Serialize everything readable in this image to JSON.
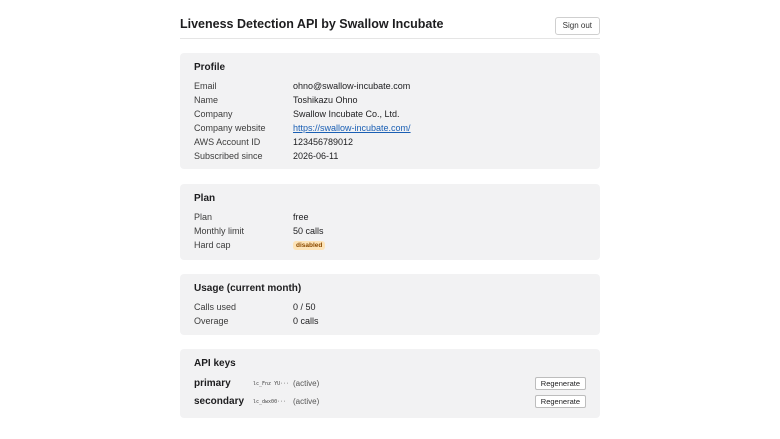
{
  "header": {
    "title": "Liveness Detection API by Swallow Incubate",
    "sign_out_label": "Sign out"
  },
  "profile": {
    "title": "Profile",
    "rows": [
      {
        "label": "Email",
        "value": "ohno@swallow-incubate.com"
      },
      {
        "label": "Name",
        "value": "Toshikazu Ohno"
      },
      {
        "label": "Company",
        "value": "Swallow Incubate Co., Ltd."
      },
      {
        "label": "Company website",
        "value": "https://swallow-incubate.com/"
      },
      {
        "label": "AWS Account ID",
        "value": "123456789012"
      },
      {
        "label": "Subscribed since",
        "value": "2026-06-11"
      }
    ]
  },
  "plan": {
    "title": "Plan",
    "rows": [
      {
        "label": "Plan",
        "value": "free"
      },
      {
        "label": "Monthly limit",
        "value": "50 calls"
      },
      {
        "label": "Hard cap",
        "value": "disabled"
      }
    ],
    "hard_cap_badge_bg": "#fde4b8",
    "hard_cap_badge_fg": "#8a4a00"
  },
  "usage": {
    "title": "Usage (current month)",
    "rows": [
      {
        "label": "Calls used",
        "value": "0 / 50"
      },
      {
        "label": "Overage",
        "value": "0 calls"
      }
    ]
  },
  "api_keys": {
    "title": "API keys",
    "keys": [
      {
        "name": "primary",
        "prefix": "lc_Fnz YU···",
        "status": "(active)",
        "action_label": "Regenerate"
      },
      {
        "name": "secondary",
        "prefix": "lc_dwx00···",
        "status": "(active)",
        "action_label": "Regenerate"
      }
    ]
  },
  "colors": {
    "page_bg": "#ffffff",
    "card_bg": "#f2f2f3",
    "link": "#1a5fb4"
  }
}
